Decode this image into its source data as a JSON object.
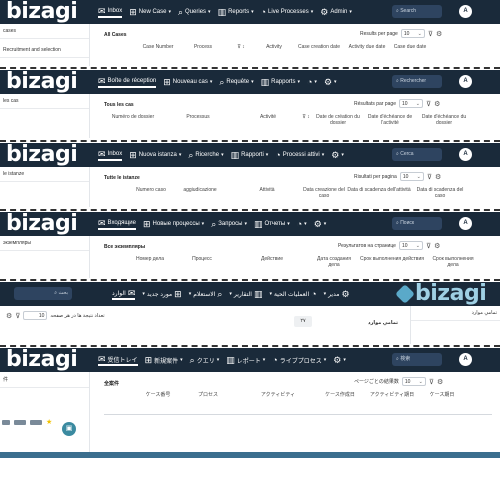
{
  "theme": {
    "header_bg": "#1a2a3a",
    "accent": "#3b6e8e",
    "white": "#ffffff"
  },
  "strips": [
    {
      "brand": "bizagi",
      "nav": [
        "Inbox",
        "New Case",
        "Queries",
        "Reports",
        "Live Processes",
        "Admin"
      ],
      "search_placeholder": "Search",
      "avatar": "A",
      "side_items": [
        "cases",
        "Recruitment and selection"
      ],
      "section_title": "All Cases",
      "rpp_label": "Results per page",
      "rpp_value": "10",
      "columns": [
        "Case Number",
        "Process",
        "",
        "Activity",
        "Case creation date",
        "Activity due date",
        "Case due date"
      ]
    },
    {
      "brand": "bizagi",
      "nav": [
        "Boîte de réception",
        "Nouveau cas",
        "Requête",
        "Rapports",
        "",
        ""
      ],
      "search_placeholder": "Rechercher",
      "avatar": "A",
      "side_items": [
        "les cas"
      ],
      "section_title": "Tous les cas",
      "rpp_label": "Résultats par page",
      "rpp_value": "10",
      "columns": [
        "Numéro de dossier",
        "Processus",
        "Activité",
        "Date de création du dossier",
        "Date d'échéance de l'activité",
        "Date d'échéance du dossier"
      ]
    },
    {
      "brand": "bizagi",
      "nav": [
        "Inbox",
        "Nuova istanza",
        "Ricerche",
        "Rapporti",
        "Processi attivi",
        ""
      ],
      "search_placeholder": "Cerca",
      "avatar": "A",
      "side_items": [
        "le istanze"
      ],
      "section_title": "Tutte le istanze",
      "rpp_label": "Risultati per pagina",
      "rpp_value": "10",
      "columns": [
        "Numero caso",
        "aggiudicazione",
        "Attività",
        "Data creazione del caso",
        "Data di scadenza dell'attività",
        "Data di scadenza del caso"
      ]
    },
    {
      "brand": "bizagi",
      "nav": [
        "Входящие",
        "Новые процессы",
        "Запросы",
        "Отчеты",
        "",
        ""
      ],
      "search_placeholder": "Поиск",
      "avatar": "A",
      "side_items": [
        "экземпляры"
      ],
      "section_title": "Все экземпляры",
      "rpp_label": "Результатов на странице",
      "rpp_value": "10",
      "columns": [
        "Номер дела",
        "Процесс",
        "Действие",
        "Дата создания дела",
        "Срок выполнения действия",
        "Срок выполнения дела"
      ]
    },
    {
      "brand": "bizagi",
      "nav": [
        "الوارد",
        "مورد جديد",
        "الاستعلام",
        "التقارير",
        "العمليات الحية",
        "مدير"
      ],
      "search_placeholder": "بحث",
      "avatar": "A",
      "side_items": [
        "تمامي موارد"
      ],
      "section_title": "تمامي موارد",
      "rpp_label": "تعداد نتيجة ها در هر صفحه",
      "rpp_value": "10",
      "badge": "٢٧",
      "columns": []
    },
    {
      "brand": "bizagi",
      "nav": [
        "受信トレイ",
        "新規案件",
        "クエリ",
        "レポート",
        "ライブプロセス",
        ""
      ],
      "search_placeholder": "検索",
      "avatar": "A",
      "side_items": [
        "件"
      ],
      "section_title": "全案件",
      "rpp_label": "ページごとの結果数",
      "rpp_value": "10",
      "columns": [
        "ケース番号",
        "プロセス",
        "アクティビティ",
        "ケース作成日",
        "アクティビティ期日",
        "ケース期日"
      ]
    }
  ]
}
